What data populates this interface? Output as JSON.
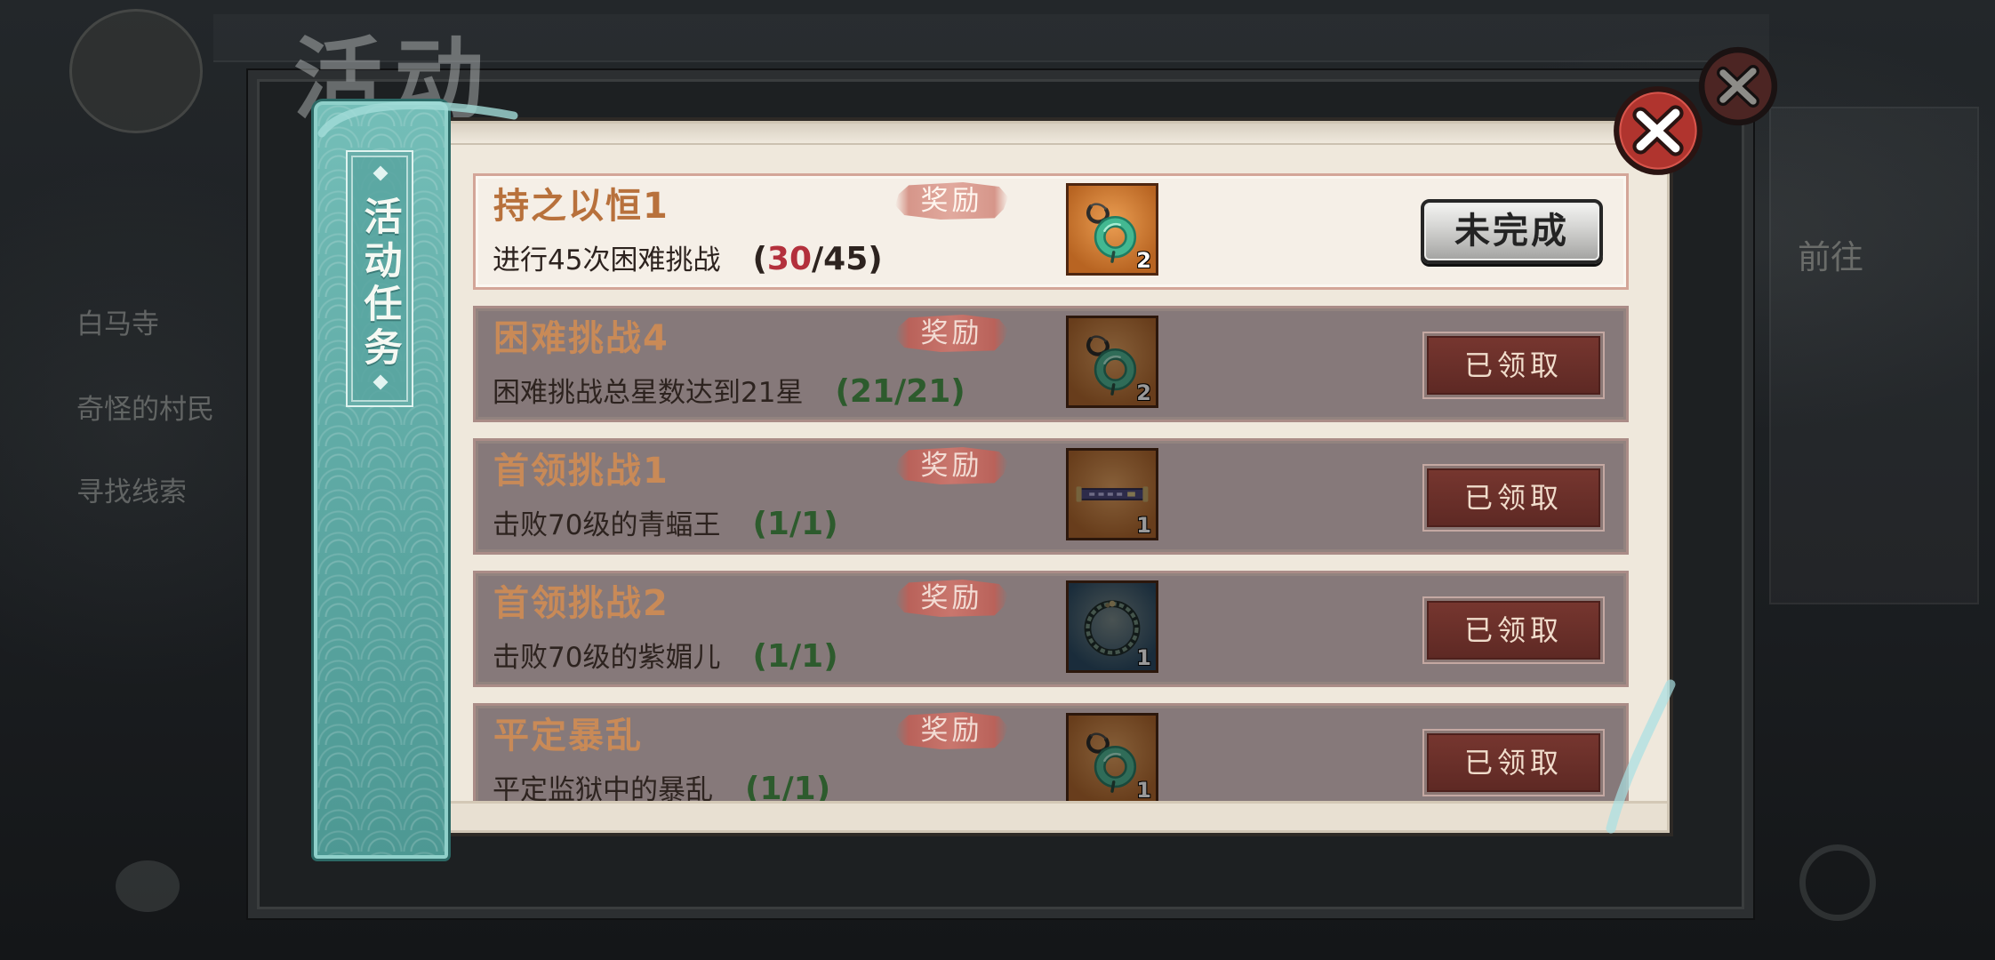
{
  "background": {
    "title": "活动",
    "sidebar_tasks": [
      "白马寺",
      "奇怪的村民",
      "寻找线索"
    ],
    "goto_label": "前往"
  },
  "tab": {
    "label": "活动任务"
  },
  "reward_label": "奖励",
  "progress_punct": {
    "open": "(",
    "sep": "/",
    "close": ")"
  },
  "colors": {
    "tab_teal": "#5ea9a4",
    "paper": "#efe8dc",
    "progress_incomplete": "#b3303c",
    "progress_complete": "#2d5b2d",
    "close_red": "#b0342e"
  },
  "close_button": {
    "icon": "close-icon"
  },
  "tasks": [
    {
      "title": "持之以恒1",
      "desc": "进行45次困难挑战",
      "progress": {
        "current": "30",
        "total": "45"
      },
      "claimed": false,
      "reward": {
        "icon": "jade-pendant-icon",
        "count": "2",
        "frame_color": "#e07a29"
      },
      "button_label": "未完成"
    },
    {
      "title": "困难挑战4",
      "desc": "困难挑战总星数达到21星",
      "progress": {
        "current": "21",
        "total": "21"
      },
      "claimed": true,
      "reward": {
        "icon": "jade-pendant-icon",
        "count": "2",
        "frame_color": "#e07a29"
      },
      "button_label": "已领取"
    },
    {
      "title": "首领挑战1",
      "desc": "击败70级的青蝠王",
      "progress": {
        "current": "1",
        "total": "1"
      },
      "claimed": true,
      "reward": {
        "icon": "scroll-icon",
        "count": "1",
        "frame_color": "#e07a29"
      },
      "button_label": "已领取"
    },
    {
      "title": "首领挑战2",
      "desc": "击败70级的紫媚儿",
      "progress": {
        "current": "1",
        "total": "1"
      },
      "claimed": true,
      "reward": {
        "icon": "bracelet-icon",
        "count": "1",
        "frame_color": "#2f5b7e"
      },
      "button_label": "已领取"
    },
    {
      "title": "平定暴乱",
      "desc": "平定监狱中的暴乱",
      "progress": {
        "current": "1",
        "total": "1"
      },
      "claimed": true,
      "reward": {
        "icon": "jade-pendant-icon",
        "count": "1",
        "frame_color": "#e07a29"
      },
      "button_label": "已领取"
    }
  ]
}
